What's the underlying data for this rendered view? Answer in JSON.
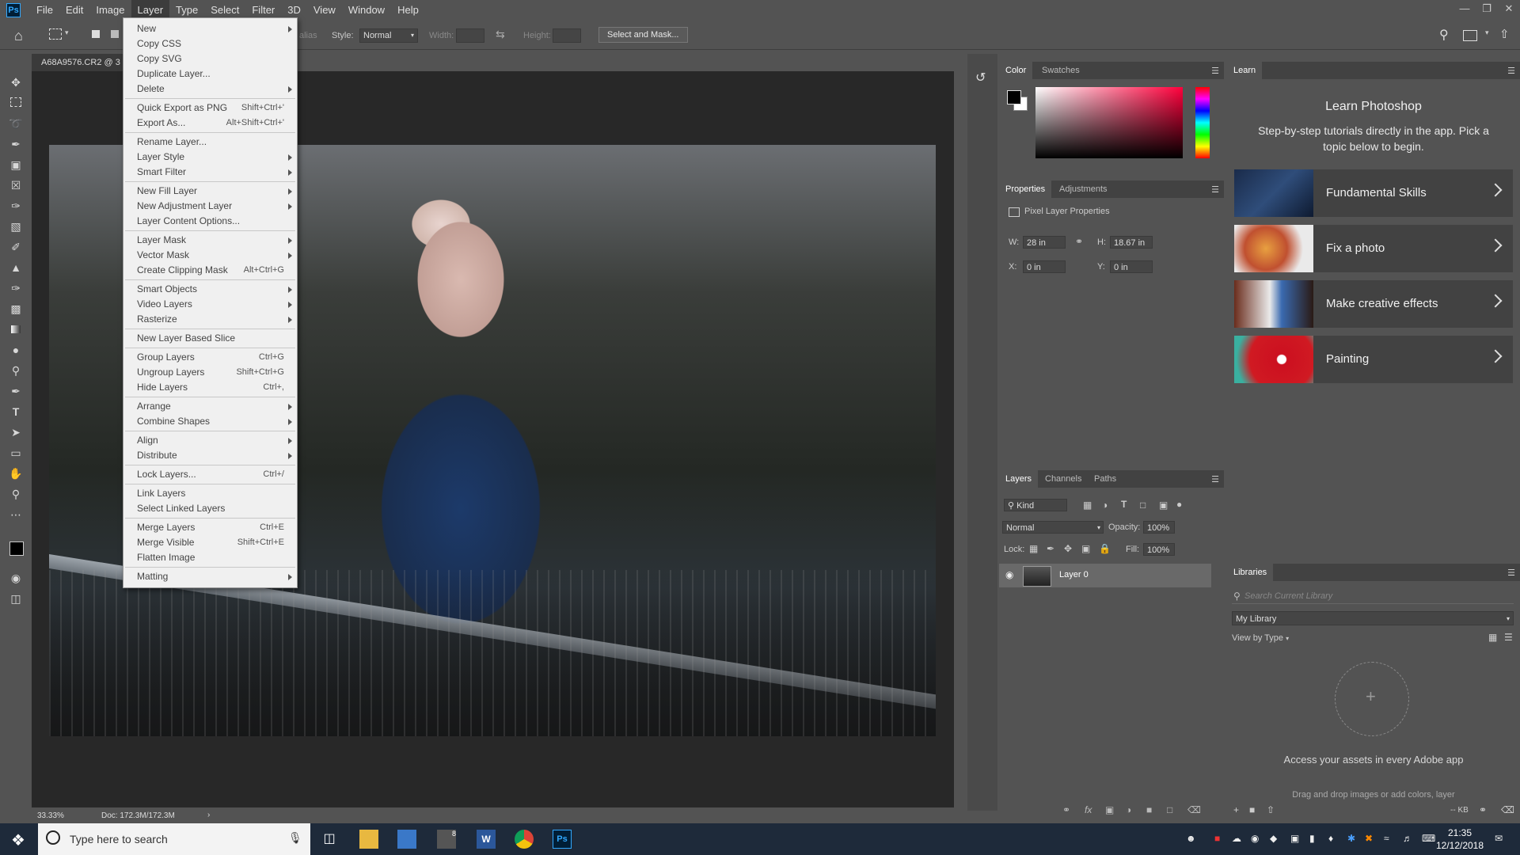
{
  "menubar": {
    "logo": "Ps",
    "items": [
      "File",
      "Edit",
      "Image",
      "Layer",
      "Type",
      "Select",
      "Filter",
      "3D",
      "View",
      "Window",
      "Help"
    ]
  },
  "options": {
    "alias": "alias",
    "style_label": "Style:",
    "style_value": "Normal",
    "width_label": "Width:",
    "height_label": "Height:",
    "select_mask": "Select and Mask..."
  },
  "document": {
    "tab": "A68A9576.CR2 @ 3",
    "zoom": "33.33%",
    "doc_size": "Doc: 172.3M/172.3M"
  },
  "layer_menu": {
    "items": [
      {
        "label": "New",
        "shortcut": "",
        "submenu": true
      },
      {
        "label": "Copy CSS",
        "shortcut": "",
        "submenu": false
      },
      {
        "label": "Copy SVG",
        "shortcut": "",
        "submenu": false
      },
      {
        "label": "Duplicate Layer...",
        "shortcut": "",
        "submenu": false
      },
      {
        "label": "Delete",
        "shortcut": "",
        "submenu": true
      },
      {
        "sep": true
      },
      {
        "label": "Quick Export as PNG",
        "shortcut": "Shift+Ctrl+'",
        "submenu": false
      },
      {
        "label": "Export As...",
        "shortcut": "Alt+Shift+Ctrl+'",
        "submenu": false
      },
      {
        "sep": true
      },
      {
        "label": "Rename Layer...",
        "shortcut": "",
        "submenu": false
      },
      {
        "label": "Layer Style",
        "shortcut": "",
        "submenu": true
      },
      {
        "label": "Smart Filter",
        "shortcut": "",
        "submenu": true
      },
      {
        "sep": true
      },
      {
        "label": "New Fill Layer",
        "shortcut": "",
        "submenu": true
      },
      {
        "label": "New Adjustment Layer",
        "shortcut": "",
        "submenu": true
      },
      {
        "label": "Layer Content Options...",
        "shortcut": "",
        "submenu": false
      },
      {
        "sep": true
      },
      {
        "label": "Layer Mask",
        "shortcut": "",
        "submenu": true
      },
      {
        "label": "Vector Mask",
        "shortcut": "",
        "submenu": true
      },
      {
        "label": "Create Clipping Mask",
        "shortcut": "Alt+Ctrl+G",
        "submenu": false
      },
      {
        "sep": true
      },
      {
        "label": "Smart Objects",
        "shortcut": "",
        "submenu": true
      },
      {
        "label": "Video Layers",
        "shortcut": "",
        "submenu": true
      },
      {
        "label": "Rasterize",
        "shortcut": "",
        "submenu": true
      },
      {
        "sep": true
      },
      {
        "label": "New Layer Based Slice",
        "shortcut": "",
        "submenu": false
      },
      {
        "sep": true
      },
      {
        "label": "Group Layers",
        "shortcut": "Ctrl+G",
        "submenu": false
      },
      {
        "label": "Ungroup Layers",
        "shortcut": "Shift+Ctrl+G",
        "submenu": false
      },
      {
        "label": "Hide Layers",
        "shortcut": "Ctrl+,",
        "submenu": false
      },
      {
        "sep": true
      },
      {
        "label": "Arrange",
        "shortcut": "",
        "submenu": true
      },
      {
        "label": "Combine Shapes",
        "shortcut": "",
        "submenu": true
      },
      {
        "sep": true
      },
      {
        "label": "Align",
        "shortcut": "",
        "submenu": true
      },
      {
        "label": "Distribute",
        "shortcut": "",
        "submenu": true
      },
      {
        "sep": true
      },
      {
        "label": "Lock Layers...",
        "shortcut": "Ctrl+/",
        "submenu": false
      },
      {
        "sep": true
      },
      {
        "label": "Link Layers",
        "shortcut": "",
        "submenu": false
      },
      {
        "label": "Select Linked Layers",
        "shortcut": "",
        "submenu": false
      },
      {
        "sep": true
      },
      {
        "label": "Merge Layers",
        "shortcut": "Ctrl+E",
        "submenu": false
      },
      {
        "label": "Merge Visible",
        "shortcut": "Shift+Ctrl+E",
        "submenu": false
      },
      {
        "label": "Flatten Image",
        "shortcut": "",
        "submenu": false
      },
      {
        "sep": true
      },
      {
        "label": "Matting",
        "shortcut": "",
        "submenu": true
      }
    ]
  },
  "color_panel": {
    "tabs": [
      "Color",
      "Swatches"
    ]
  },
  "properties": {
    "tabs": [
      "Properties",
      "Adjustments"
    ],
    "title": "Pixel Layer Properties",
    "w_label": "W:",
    "w": "28 in",
    "h_label": "H:",
    "h": "18.67 in",
    "x_label": "X:",
    "x": "0 in",
    "y_label": "Y:",
    "y": "0 in"
  },
  "layers": {
    "tabs": [
      "Layers",
      "Channels",
      "Paths"
    ],
    "kind": "Kind",
    "blend": "Normal",
    "opacity_label": "Opacity:",
    "opacity": "100%",
    "lock_label": "Lock:",
    "fill_label": "Fill:",
    "fill": "100%",
    "layer_name": "Layer 0"
  },
  "learn": {
    "tab": "Learn",
    "title": "Learn Photoshop",
    "subtitle": "Step-by-step tutorials directly in the app. Pick a topic below to begin.",
    "cards": [
      "Fundamental Skills",
      "Fix a photo",
      "Make creative effects",
      "Painting"
    ]
  },
  "libraries": {
    "tab": "Libraries",
    "search_placeholder": "Search Current Library",
    "library": "My Library",
    "view_by": "View by Type",
    "empty_title": "Access your assets in every Adobe app",
    "empty_sub": "Drag and drop images or add colors, layer",
    "kb": "-- KB"
  },
  "taskbar": {
    "search_placeholder": "Type here to search",
    "time": "21:35",
    "date": "12/12/2018",
    "mail_badge": "8"
  }
}
